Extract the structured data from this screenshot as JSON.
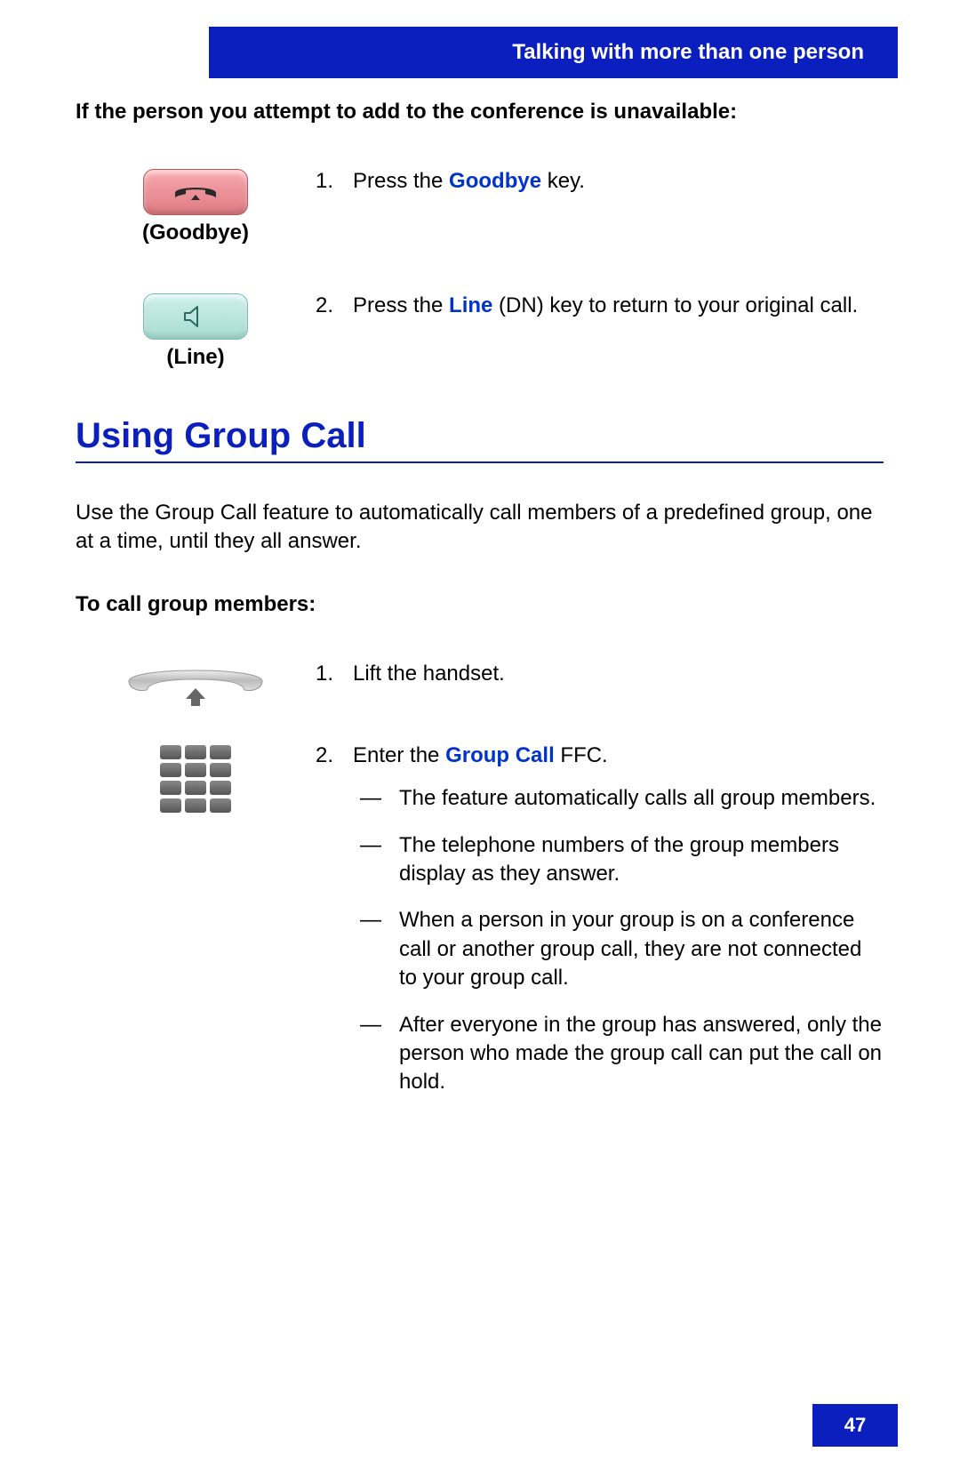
{
  "header": {
    "title": "Talking with more than one person"
  },
  "s1_title": "If the person you attempt to add to the conference is unavailable:",
  "step1": {
    "icon_label": "(Goodbye)",
    "num": "1.",
    "pre": "Press the ",
    "link": "Goodbye",
    "post": " key."
  },
  "step2": {
    "icon_label": "(Line)",
    "num": "2.",
    "pre": "Press the ",
    "link": "Line",
    "post": " (DN) key to return to your original call."
  },
  "section2": {
    "title": "Using Group Call",
    "intro": "Use the Group Call feature to automatically call members of a predefined group, one at a time, until they all answer.",
    "subtitle": "To call group members:"
  },
  "g_step1": {
    "num": "1.",
    "text": "Lift the handset."
  },
  "g_step2": {
    "num": "2.",
    "pre": "Enter the ",
    "link": "Group Call",
    "post": " FFC.",
    "bullets": [
      "The feature automatically calls all group members.",
      "The telephone numbers of the group members display as they answer.",
      "When a person in your group is on a conference call or another group call, they are not connected to your group call.",
      "After everyone in the group has answered, only the person who made the group call can put the call on hold."
    ]
  },
  "page_number": "47"
}
